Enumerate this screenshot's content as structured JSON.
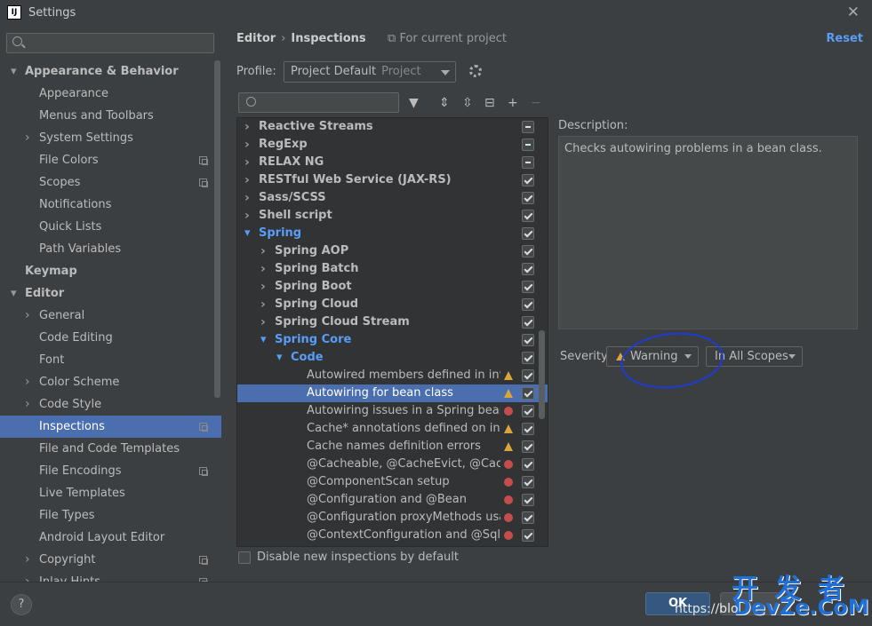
{
  "window": {
    "title": "Settings",
    "icon_text": "IJ"
  },
  "sidebar": {
    "items": [
      {
        "label": "Appearance & Behavior",
        "level": 0,
        "arrow": "down",
        "bold": true
      },
      {
        "label": "Appearance",
        "level": 1
      },
      {
        "label": "Menus and Toolbars",
        "level": 1
      },
      {
        "label": "System Settings",
        "level": 1,
        "arrow": "right"
      },
      {
        "label": "File Colors",
        "level": 1,
        "copy": true
      },
      {
        "label": "Scopes",
        "level": 1,
        "copy": true
      },
      {
        "label": "Notifications",
        "level": 1
      },
      {
        "label": "Quick Lists",
        "level": 1
      },
      {
        "label": "Path Variables",
        "level": 1
      },
      {
        "label": "Keymap",
        "level": 0,
        "bold": true
      },
      {
        "label": "Editor",
        "level": 0,
        "arrow": "down",
        "bold": true
      },
      {
        "label": "General",
        "level": 1,
        "arrow": "right"
      },
      {
        "label": "Code Editing",
        "level": 1
      },
      {
        "label": "Font",
        "level": 1
      },
      {
        "label": "Color Scheme",
        "level": 1,
        "arrow": "right"
      },
      {
        "label": "Code Style",
        "level": 1,
        "arrow": "right"
      },
      {
        "label": "Inspections",
        "level": 1,
        "copy": true,
        "selected": true
      },
      {
        "label": "File and Code Templates",
        "level": 1
      },
      {
        "label": "File Encodings",
        "level": 1,
        "copy": true
      },
      {
        "label": "Live Templates",
        "level": 1
      },
      {
        "label": "File Types",
        "level": 1
      },
      {
        "label": "Android Layout Editor",
        "level": 1
      },
      {
        "label": "Copyright",
        "level": 1,
        "arrow": "right",
        "copy": true
      },
      {
        "label": "Inlay Hints",
        "level": 1,
        "arrow": "right",
        "copy": true
      }
    ]
  },
  "header": {
    "breadcrumb_1": "Editor",
    "breadcrumb_sep": "›",
    "breadcrumb_2": "Inspections",
    "for_project": "For current project",
    "reset": "Reset"
  },
  "profile": {
    "label": "Profile:",
    "value": "Project Default",
    "hint": "Project"
  },
  "inspections": [
    {
      "label": "Reactive Streams",
      "level": 0,
      "arrow": "right",
      "bold": true,
      "check": "mixed"
    },
    {
      "label": "RegExp",
      "level": 0,
      "arrow": "right",
      "bold": true,
      "check": "mixed"
    },
    {
      "label": "RELAX NG",
      "level": 0,
      "arrow": "right",
      "bold": true,
      "check": "mixed"
    },
    {
      "label": "RESTful Web Service (JAX-RS)",
      "level": 0,
      "arrow": "right",
      "bold": true,
      "check": "checked"
    },
    {
      "label": "Sass/SCSS",
      "level": 0,
      "arrow": "right",
      "bold": true,
      "check": "checked"
    },
    {
      "label": "Shell script",
      "level": 0,
      "arrow": "right",
      "bold": true,
      "check": "checked"
    },
    {
      "label": "Spring",
      "level": 0,
      "arrow": "down",
      "bold": true,
      "blue": true,
      "check": "checked"
    },
    {
      "label": "Spring AOP",
      "level": 1,
      "arrow": "right",
      "bold": true,
      "check": "checked"
    },
    {
      "label": "Spring Batch",
      "level": 1,
      "arrow": "right",
      "bold": true,
      "check": "checked"
    },
    {
      "label": "Spring Boot",
      "level": 1,
      "arrow": "right",
      "bold": true,
      "check": "checked"
    },
    {
      "label": "Spring Cloud",
      "level": 1,
      "arrow": "right",
      "bold": true,
      "check": "checked"
    },
    {
      "label": "Spring Cloud Stream",
      "level": 1,
      "arrow": "right",
      "bold": true,
      "check": "checked"
    },
    {
      "label": "Spring Core",
      "level": 1,
      "arrow": "down",
      "bold": true,
      "blue": true,
      "check": "checked"
    },
    {
      "label": "Code",
      "level": 2,
      "arrow": "down",
      "bold": true,
      "blue": true,
      "check": "checked"
    },
    {
      "label": "Autowired members defined in invalid Spring bean",
      "level": 3,
      "sev": "warn",
      "check": "checked"
    },
    {
      "label": "Autowiring for bean class",
      "level": 3,
      "sev": "warn",
      "check": "checked",
      "selected": true
    },
    {
      "label": "Autowiring issues in a Spring bean class",
      "level": 3,
      "sev": "err",
      "check": "checked"
    },
    {
      "label": "Cache* annotations defined on interface/interface method",
      "level": 3,
      "sev": "warn",
      "check": "checked"
    },
    {
      "label": "Cache names definition errors",
      "level": 3,
      "sev": "warn",
      "check": "checked"
    },
    {
      "label": "@Cacheable, @CacheEvict, @CachePut",
      "level": 3,
      "sev": "err",
      "check": "checked"
    },
    {
      "label": "@ComponentScan setup",
      "level": 3,
      "sev": "err",
      "check": "checked"
    },
    {
      "label": "@Configuration and @Bean",
      "level": 3,
      "sev": "err",
      "check": "checked"
    },
    {
      "label": "@Configuration proxyMethods usage",
      "level": 3,
      "sev": "err",
      "check": "checked"
    },
    {
      "label": "@ContextConfiguration and @SqlConfig",
      "level": 3,
      "sev": "err",
      "check": "checked"
    }
  ],
  "disable_new": "Disable new inspections by default",
  "description": {
    "label": "Description:",
    "text": "Checks autowiring problems in a bean class."
  },
  "severity": {
    "label": "Severity:",
    "value": "Warning",
    "scope": "In All Scopes"
  },
  "footer": {
    "help": "?",
    "ok": "OK"
  },
  "watermark": {
    "url": "https://blo",
    "logo_top": "开 发 者",
    "logo_bottom": "DevZe.CoM"
  },
  "colors": {
    "selection": "#4b6eaf",
    "link": "#589df6",
    "warn": "#d9a53c",
    "error": "#c64d4d",
    "annotation_circle": "#1d3bd6"
  }
}
